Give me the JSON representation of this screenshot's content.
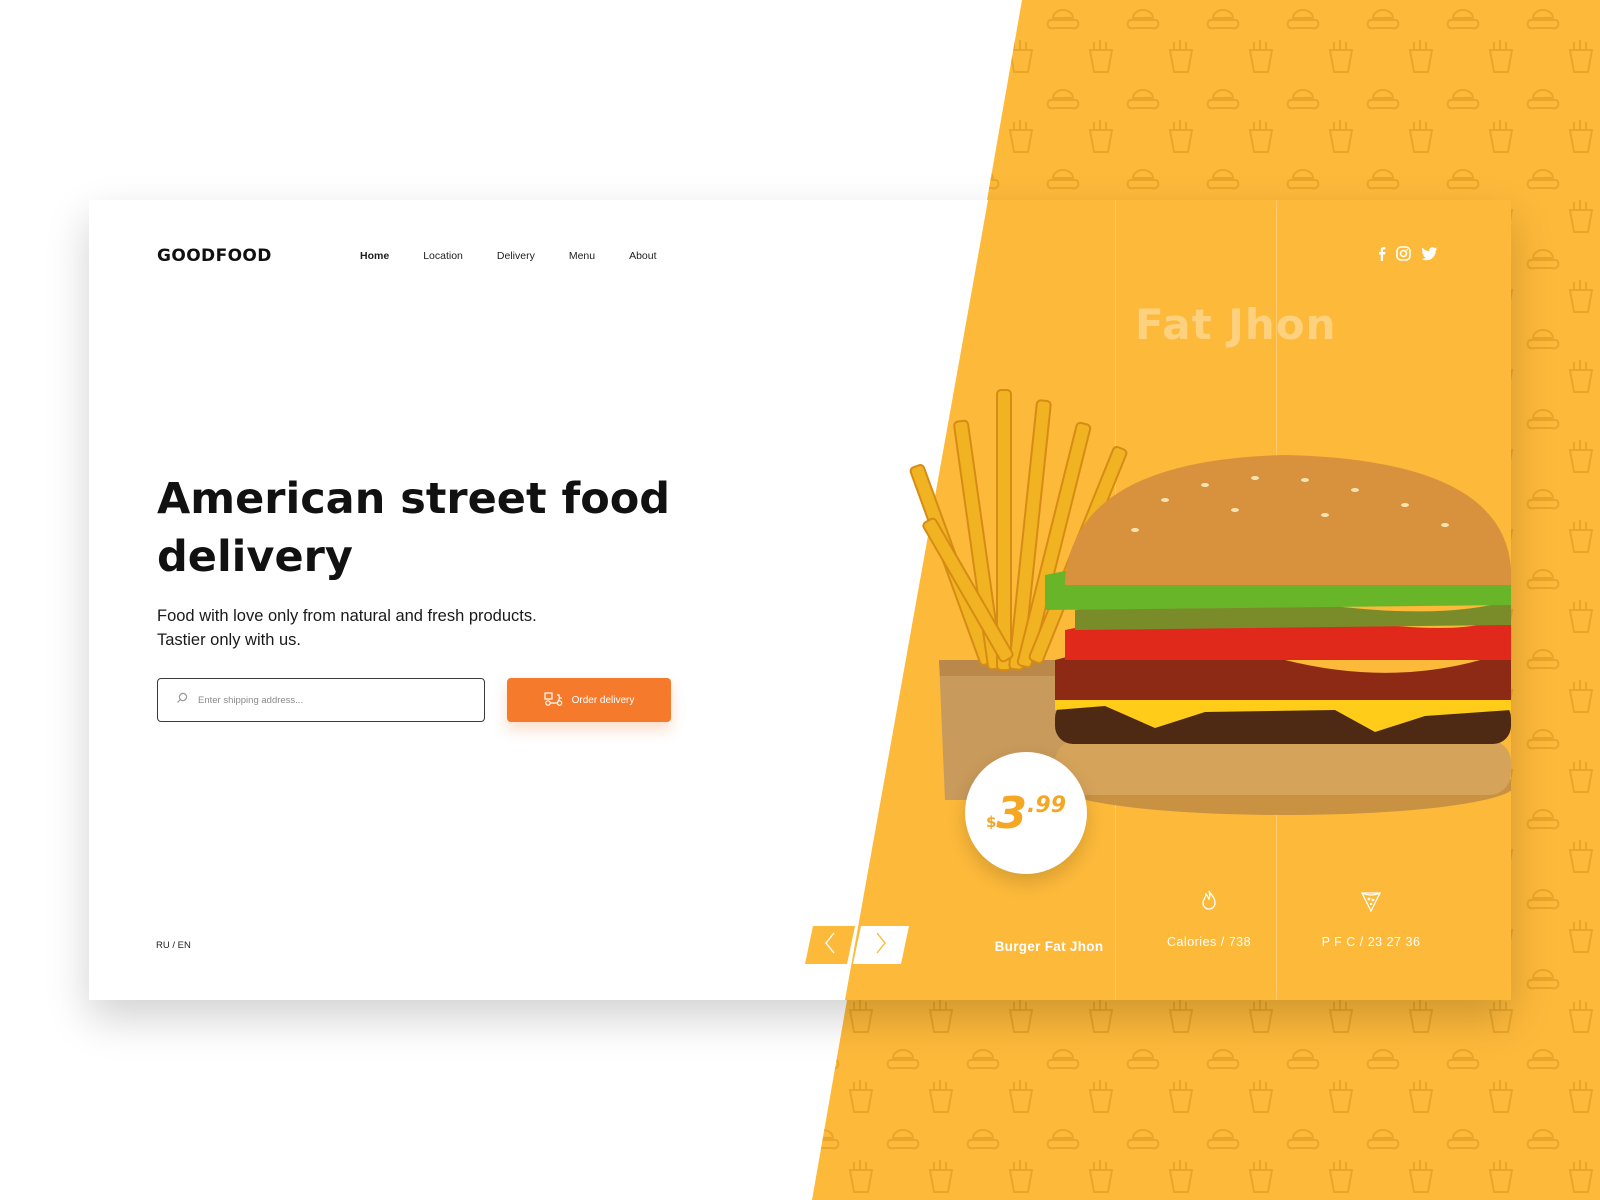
{
  "brand": {
    "logo": "GOODFOOD"
  },
  "nav": {
    "items": [
      {
        "label": "Home",
        "active": true
      },
      {
        "label": "Location",
        "active": false
      },
      {
        "label": "Delivery",
        "active": false
      },
      {
        "label": "Menu",
        "active": false
      },
      {
        "label": "About",
        "active": false
      }
    ]
  },
  "social": [
    "facebook-icon",
    "instagram-icon",
    "twitter-icon"
  ],
  "hero": {
    "title": "American street food delivery",
    "subtitle_line1": "Food with love only from natural and fresh products.",
    "subtitle_line2": "Tastier only with us."
  },
  "search": {
    "placeholder": "Enter shipping address...",
    "value": ""
  },
  "order_button": {
    "label": "Order delivery"
  },
  "lang": {
    "label": "RU / EN"
  },
  "product": {
    "ghost_title": "Fat Jhon",
    "name": "Burger Fat Jhon",
    "calories": "Calories / 738",
    "pfc": "P F C / 23  27  36",
    "price_currency": "$",
    "price_main": "3",
    "price_cents": ".99"
  },
  "colors": {
    "accent_yellow": "#fcb93a",
    "button_orange": "#f57a2b",
    "text_dark": "#111111"
  }
}
